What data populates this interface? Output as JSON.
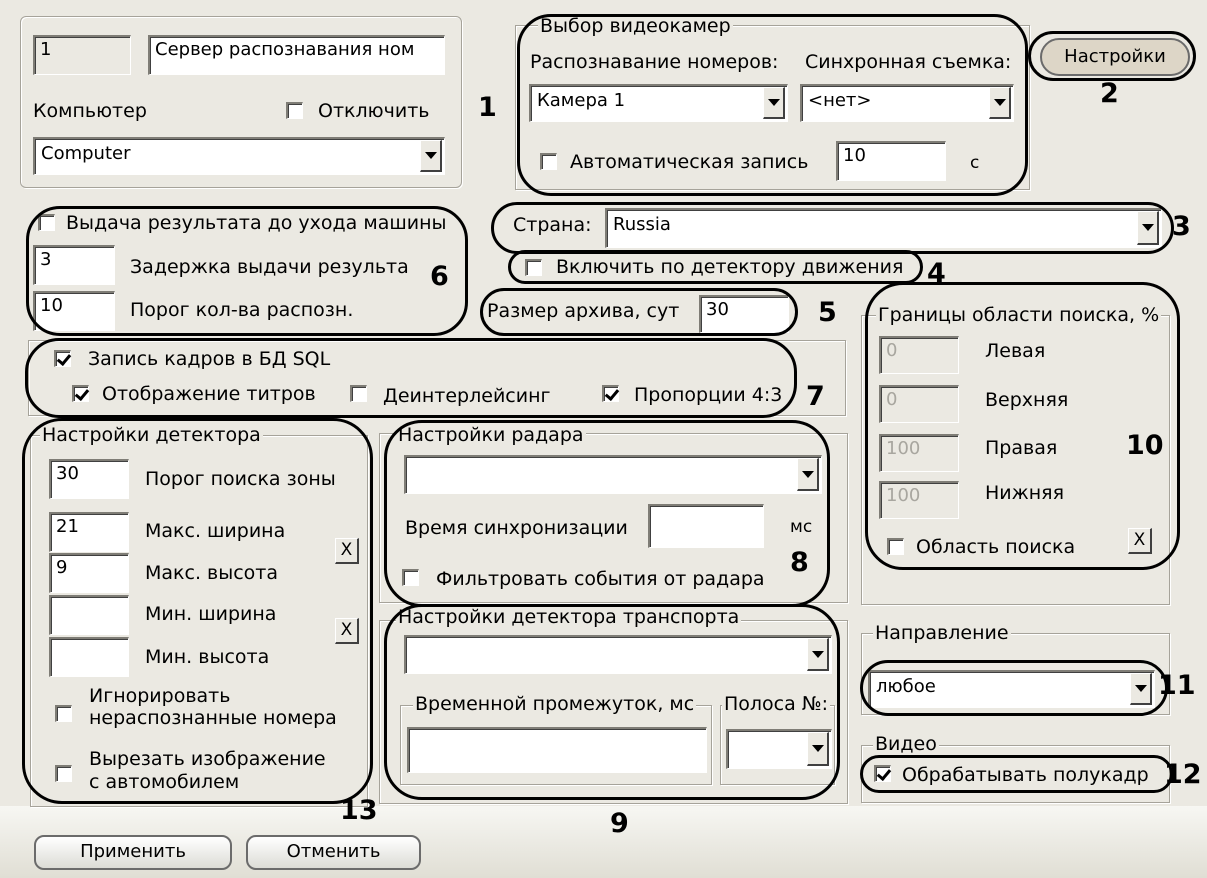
{
  "top": {
    "id_value": "1",
    "name_value": "Сервер распознавания ном",
    "computer_label": "Компьютер",
    "disable_label": "Отключить",
    "computer_value": "Computer"
  },
  "cameras": {
    "title": "Выбор видеокамер",
    "recognition_label": "Распознавание номеров:",
    "sync_label": "Синхронная съемка:",
    "recognition_value": "Камера 1",
    "sync_value": "<нет>",
    "autorecord_label": "Автоматическая запись",
    "autorecord_value": "10",
    "autorecord_unit": "с",
    "settings_button": "Настройки"
  },
  "result": {
    "before_leave_label": "Выдача результата до ухода машины",
    "delay_value": "3",
    "delay_label": "Задержка выдачи результа",
    "threshold_value": "10",
    "threshold_label": "Порог кол-ва распозн."
  },
  "country": {
    "label": "Страна:",
    "value": "Russia"
  },
  "motion_label": "Включить по детектору движения",
  "archive": {
    "label": "Размер архива, сут",
    "value": "30"
  },
  "sql": {
    "record_label": "Запись кадров в БД SQL",
    "titles_label": "Отображение титров",
    "deinterlace_label": "Деинтерлейсинг",
    "aspect_label": "Пропорции 4:3"
  },
  "bounds": {
    "title": "Границы области поиска, %",
    "left_value": "0",
    "left_label": "Левая",
    "top_value": "0",
    "top_label": "Верхняя",
    "right_value": "100",
    "right_label": "Правая",
    "bottom_value": "100",
    "bottom_label": "Нижняя",
    "area_label": "Область поиска",
    "x_label": "X"
  },
  "detector": {
    "title": "Настройки детектора",
    "zone_value": "30",
    "zone_label": "Порог поиска зоны",
    "maxw_value": "21",
    "maxw_label": "Макс. ширина",
    "maxh_value": "9",
    "maxh_label": "Макс. высота",
    "minw_value": "",
    "minw_label": "Мин. ширина",
    "minh_value": "",
    "minh_label": "Мин. высота",
    "x_label": "X",
    "ignore_line1": "Игнорировать",
    "ignore_line2": "нераспознанные номера",
    "cut_line1": "Вырезать изображение",
    "cut_line2": "с автомобилем"
  },
  "radar": {
    "title": "Настройки радара",
    "select_value": "",
    "sync_label": "Время синхронизации",
    "sync_value": "",
    "sync_unit": "мс",
    "filter_label": "Фильтровать события от радара"
  },
  "transport": {
    "title": "Настройки детектора транспорта",
    "select_value": "",
    "interval_title": "Временной промежуток, мс",
    "interval_value": "",
    "lane_title": "Полоса №:",
    "lane_value": ""
  },
  "direction": {
    "title": "Направление",
    "value": "любое"
  },
  "video": {
    "title": "Видео",
    "half_frame_label": "Обрабатывать полукадр"
  },
  "buttons": {
    "apply": "Применить",
    "cancel": "Отменить"
  },
  "callouts": [
    "1",
    "2",
    "3",
    "4",
    "5",
    "6",
    "7",
    "8",
    "9",
    "10",
    "11",
    "12",
    "13"
  ]
}
